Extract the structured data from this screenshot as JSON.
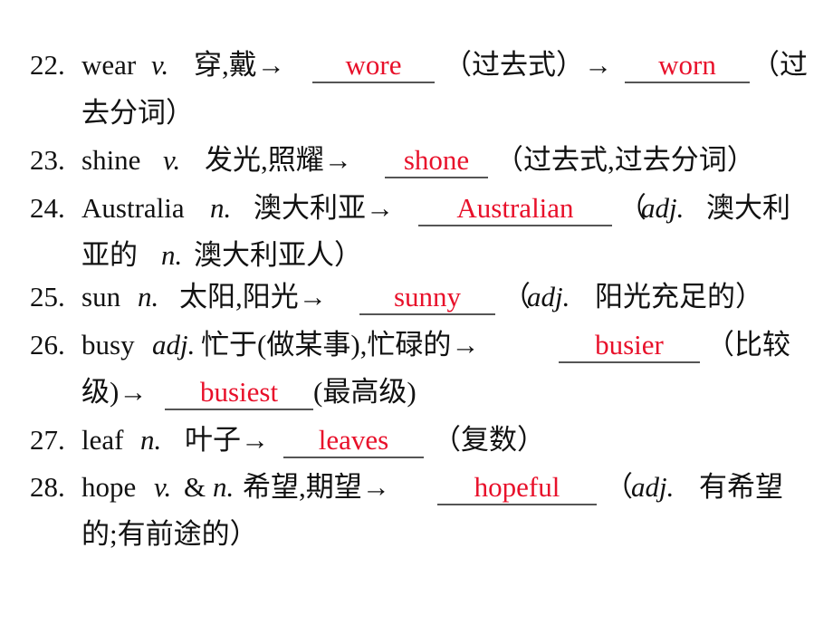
{
  "document": {
    "accent_color": "#e8102a",
    "items": [
      {
        "number": "22.",
        "word": "wear",
        "pos": "v.",
        "meaning": "穿,戴→",
        "answers": [
          "wore",
          "worn"
        ],
        "after_1": "（过去式）→",
        "after_2": "（过",
        "continuation": "去分词）"
      },
      {
        "number": "23.",
        "word": "shine",
        "pos": "v.",
        "meaning": "发光,照耀→",
        "answers": [
          "shone"
        ],
        "after_1": "（过去式,过去分词）"
      },
      {
        "number": "24.",
        "word": "Australia",
        "pos": "n.",
        "meaning": "澳大利亚→",
        "answers": [
          "Australian"
        ],
        "after_1_open": "（",
        "after_1_pos": "adj.",
        "after_1_text": "澳大利",
        "continuation_1": "亚的",
        "continuation_pos": "n.",
        "continuation_2": "澳大利亚人）"
      },
      {
        "number": "25.",
        "word": "sun",
        "pos": "n.",
        "meaning": "太阳,阳光→",
        "answers": [
          "sunny"
        ],
        "after_1_open": "（",
        "after_1_pos": "adj.",
        "after_1_text": "阳光充足的）"
      },
      {
        "number": "26.",
        "word": "busy",
        "pos": "adj.",
        "meaning": "忙于(做某事),忙碌的→",
        "answers": [
          "busier",
          "busiest"
        ],
        "after_1": "（比较",
        "continuation_1": "级)→",
        "after_2": "(最高级)"
      },
      {
        "number": "27.",
        "word": "leaf",
        "pos": "n.",
        "meaning": "叶子→",
        "answers": [
          "leaves"
        ],
        "after_1": "（复数）"
      },
      {
        "number": "28.",
        "word": "hope",
        "pos_1": "v.",
        "amp": "&",
        "pos_2": "n.",
        "meaning": "希望,期望→",
        "answers": [
          "hopeful"
        ],
        "after_1_open": "（",
        "after_1_pos": "adj.",
        "after_1_text": "有希望",
        "continuation": "的;有前途的）"
      }
    ]
  }
}
